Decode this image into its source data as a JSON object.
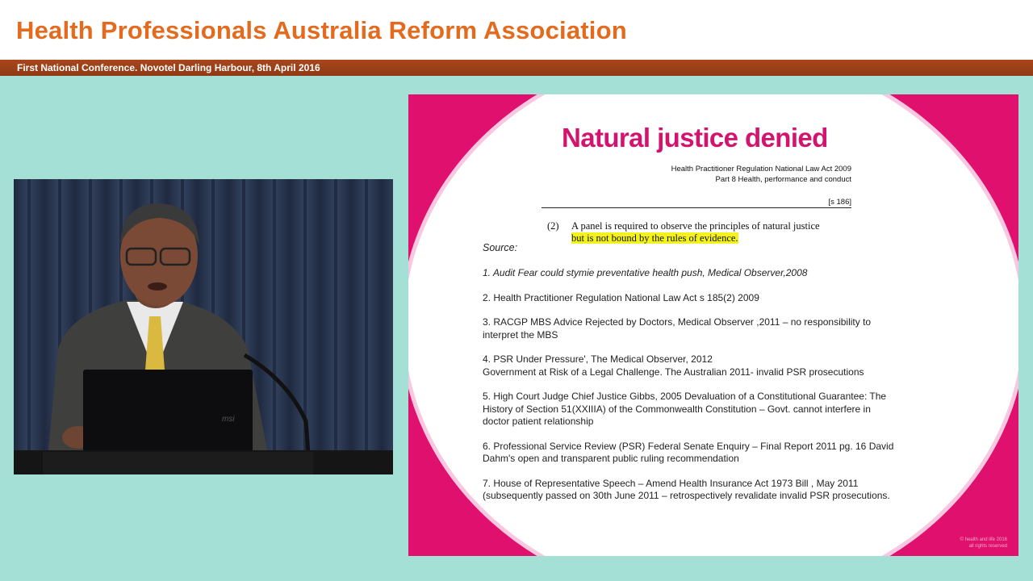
{
  "header": {
    "title": "Health Professionals Australia Reform Association",
    "subtitle": "First National Conference. Novotel Darling Harbour, 8th April 2016"
  },
  "video": {
    "laptop_brand": "msi"
  },
  "slide": {
    "title": "Natural justice denied",
    "act_line1": "Health Practitioner Regulation National Law Act 2009",
    "act_line2": "Part 8 Health, performance and conduct",
    "section_ref": "[s 186]",
    "clause_number": "(2)",
    "clause_line1": "A panel is required to observe the principles of natural justice",
    "clause_line2": "but is not bound by the rules of evidence.",
    "source_label": "Source:",
    "references": [
      {
        "lines": [
          "1. Audit Fear could stymie preventative health push, Medical Observer,2008"
        ]
      },
      {
        "lines": [
          "2. Health Practitioner Regulation National Law Act s 185(2) 2009"
        ]
      },
      {
        "lines": [
          "3. RACGP MBS Advice Rejected  by Doctors, Medical Observer ,2011 – no responsibility to",
          "interpret the MBS"
        ]
      },
      {
        "lines": [
          "4. PSR Under Pressure', The  Medical Observer, 2012",
          "Government at Risk of a Legal Challenge. The  Australian 2011- invalid PSR prosecutions"
        ]
      },
      {
        "lines": [
          "5. High Court Judge Chief Justice Gibbs, 2005  Devaluation of a Constitutional Guarantee:  The",
          "History of Section 51(XXIIIA) of the Commonwealth Constitution – Govt. cannot interfere in",
          "doctor patient relationship"
        ]
      },
      {
        "lines": [
          "6. Professional Service Review (PSR) Federal Senate Enquiry – Final Report 2011 pg. 16 David",
          "Dahm's  open and transparent  public ruling recommendation"
        ]
      },
      {
        "lines": [
          "7. House of Representative Speech – Amend Health Insurance Act 1973 Bill , May 2011",
          "(subsequently passed on 30th June 2011 – retrospectively revalidate invalid PSR prosecutions."
        ]
      }
    ],
    "copyright_line1": "© health and life 2016",
    "copyright_line2": "all rights reserved"
  },
  "colors": {
    "header_title": "#e46a1e",
    "subbar": "#a8461c",
    "background": "#a4e0d6",
    "slide_magenta": "#e0106f",
    "highlight": "#f4f21c"
  }
}
